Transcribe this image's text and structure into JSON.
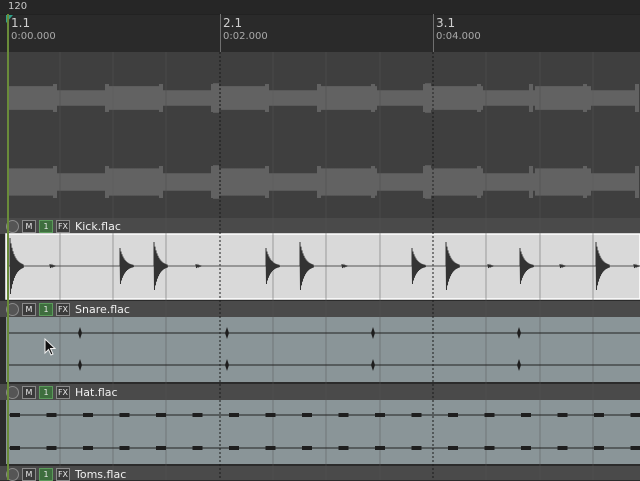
{
  "ruler": {
    "tempo": "120",
    "bars": [
      {
        "bar": "1.1",
        "time": "0:00.000"
      },
      {
        "bar": "2.1",
        "time": "0:02.000"
      },
      {
        "bar": "3.1",
        "time": "0:04.000"
      }
    ]
  },
  "items": [
    {
      "name": "Kick.flac",
      "selected": true
    },
    {
      "name": "Snare.flac",
      "selected": false
    },
    {
      "name": "Hat.flac",
      "selected": false
    },
    {
      "name": "Toms.flac",
      "selected": false
    }
  ],
  "item_buttons": {
    "mute": "M",
    "take": "1",
    "fx": "FX"
  },
  "colors": {
    "selected_item_bg": "#d9d9d9",
    "item_bg": "#8a9598",
    "header_bg": "#4a4a4a",
    "waveform_dark": "#3a3a3a",
    "playhead": "#6a8c3a"
  }
}
